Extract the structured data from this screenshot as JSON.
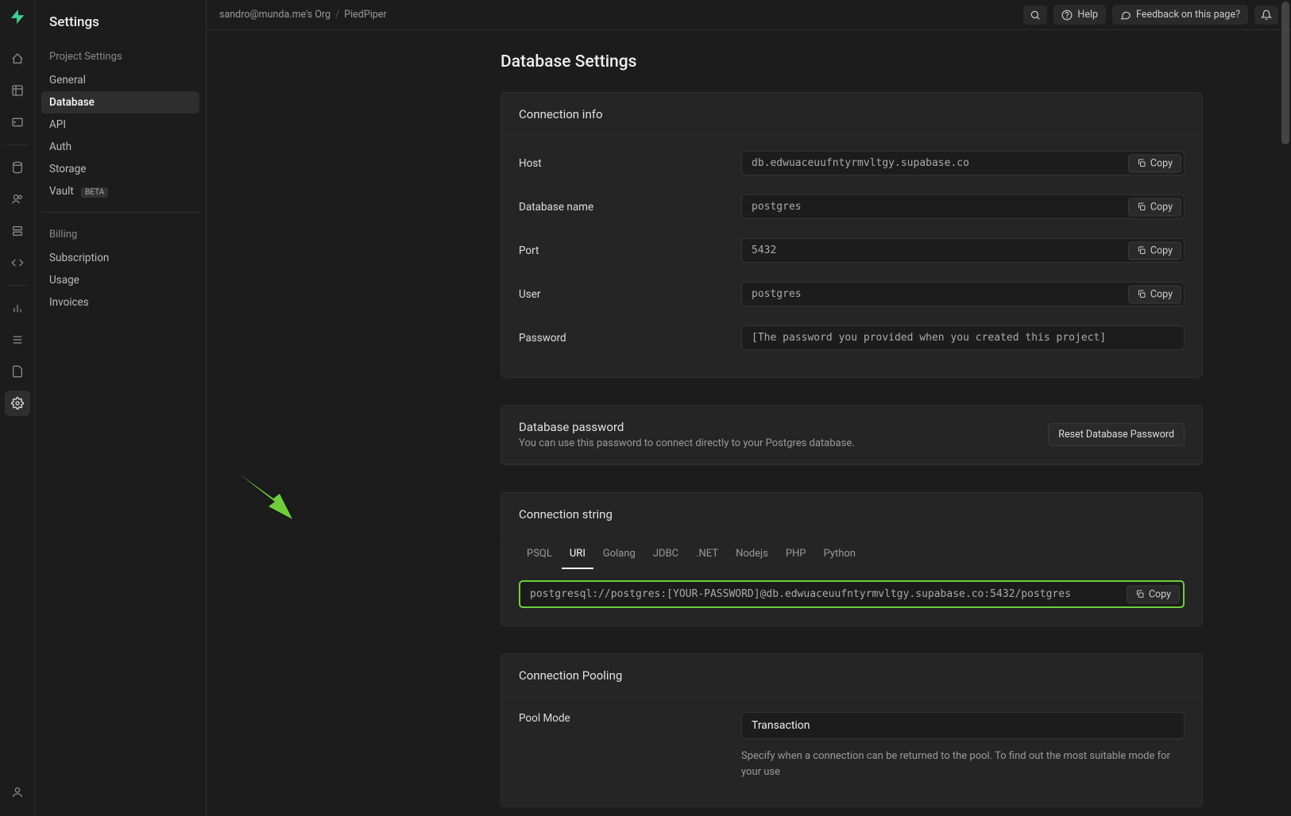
{
  "header": {
    "title": "Settings",
    "breadcrumb_org": "sandro@munda.me's Org",
    "breadcrumb_project": "PiedPiper",
    "help_label": "Help",
    "feedback_label": "Feedback on this page?"
  },
  "sidebar": {
    "section1_title": "Project Settings",
    "items1": [
      {
        "label": "General"
      },
      {
        "label": "Database"
      },
      {
        "label": "API"
      },
      {
        "label": "Auth"
      },
      {
        "label": "Storage"
      },
      {
        "label": "Vault",
        "badge": "BETA"
      }
    ],
    "section2_title": "Billing",
    "items2": [
      {
        "label": "Subscription"
      },
      {
        "label": "Usage"
      },
      {
        "label": "Invoices"
      }
    ]
  },
  "page": {
    "title": "Database Settings"
  },
  "connection_info": {
    "title": "Connection info",
    "host_label": "Host",
    "host_value": "db.edwuaceuufntyrmvltgy.supabase.co",
    "dbname_label": "Database name",
    "dbname_value": "postgres",
    "port_label": "Port",
    "port_value": "5432",
    "user_label": "User",
    "user_value": "postgres",
    "password_label": "Password",
    "password_value": "[The password you provided when you created this project]",
    "copy_label": "Copy"
  },
  "db_password": {
    "title": "Database password",
    "subtitle": "You can use this password to connect directly to your Postgres database.",
    "reset_label": "Reset Database Password"
  },
  "connection_string": {
    "title": "Connection string",
    "tabs": [
      "PSQL",
      "URI",
      "Golang",
      "JDBC",
      ".NET",
      "Nodejs",
      "PHP",
      "Python"
    ],
    "active_tab": "URI",
    "value": "postgresql://postgres:[YOUR-PASSWORD]@db.edwuaceuufntyrmvltgy.supabase.co:5432/postgres",
    "copy_label": "Copy"
  },
  "pooling": {
    "title": "Connection Pooling",
    "pool_mode_label": "Pool Mode",
    "pool_mode_value": "Transaction",
    "help_text": "Specify when a connection can be returned to the pool. To find out the most suitable mode for your use"
  }
}
